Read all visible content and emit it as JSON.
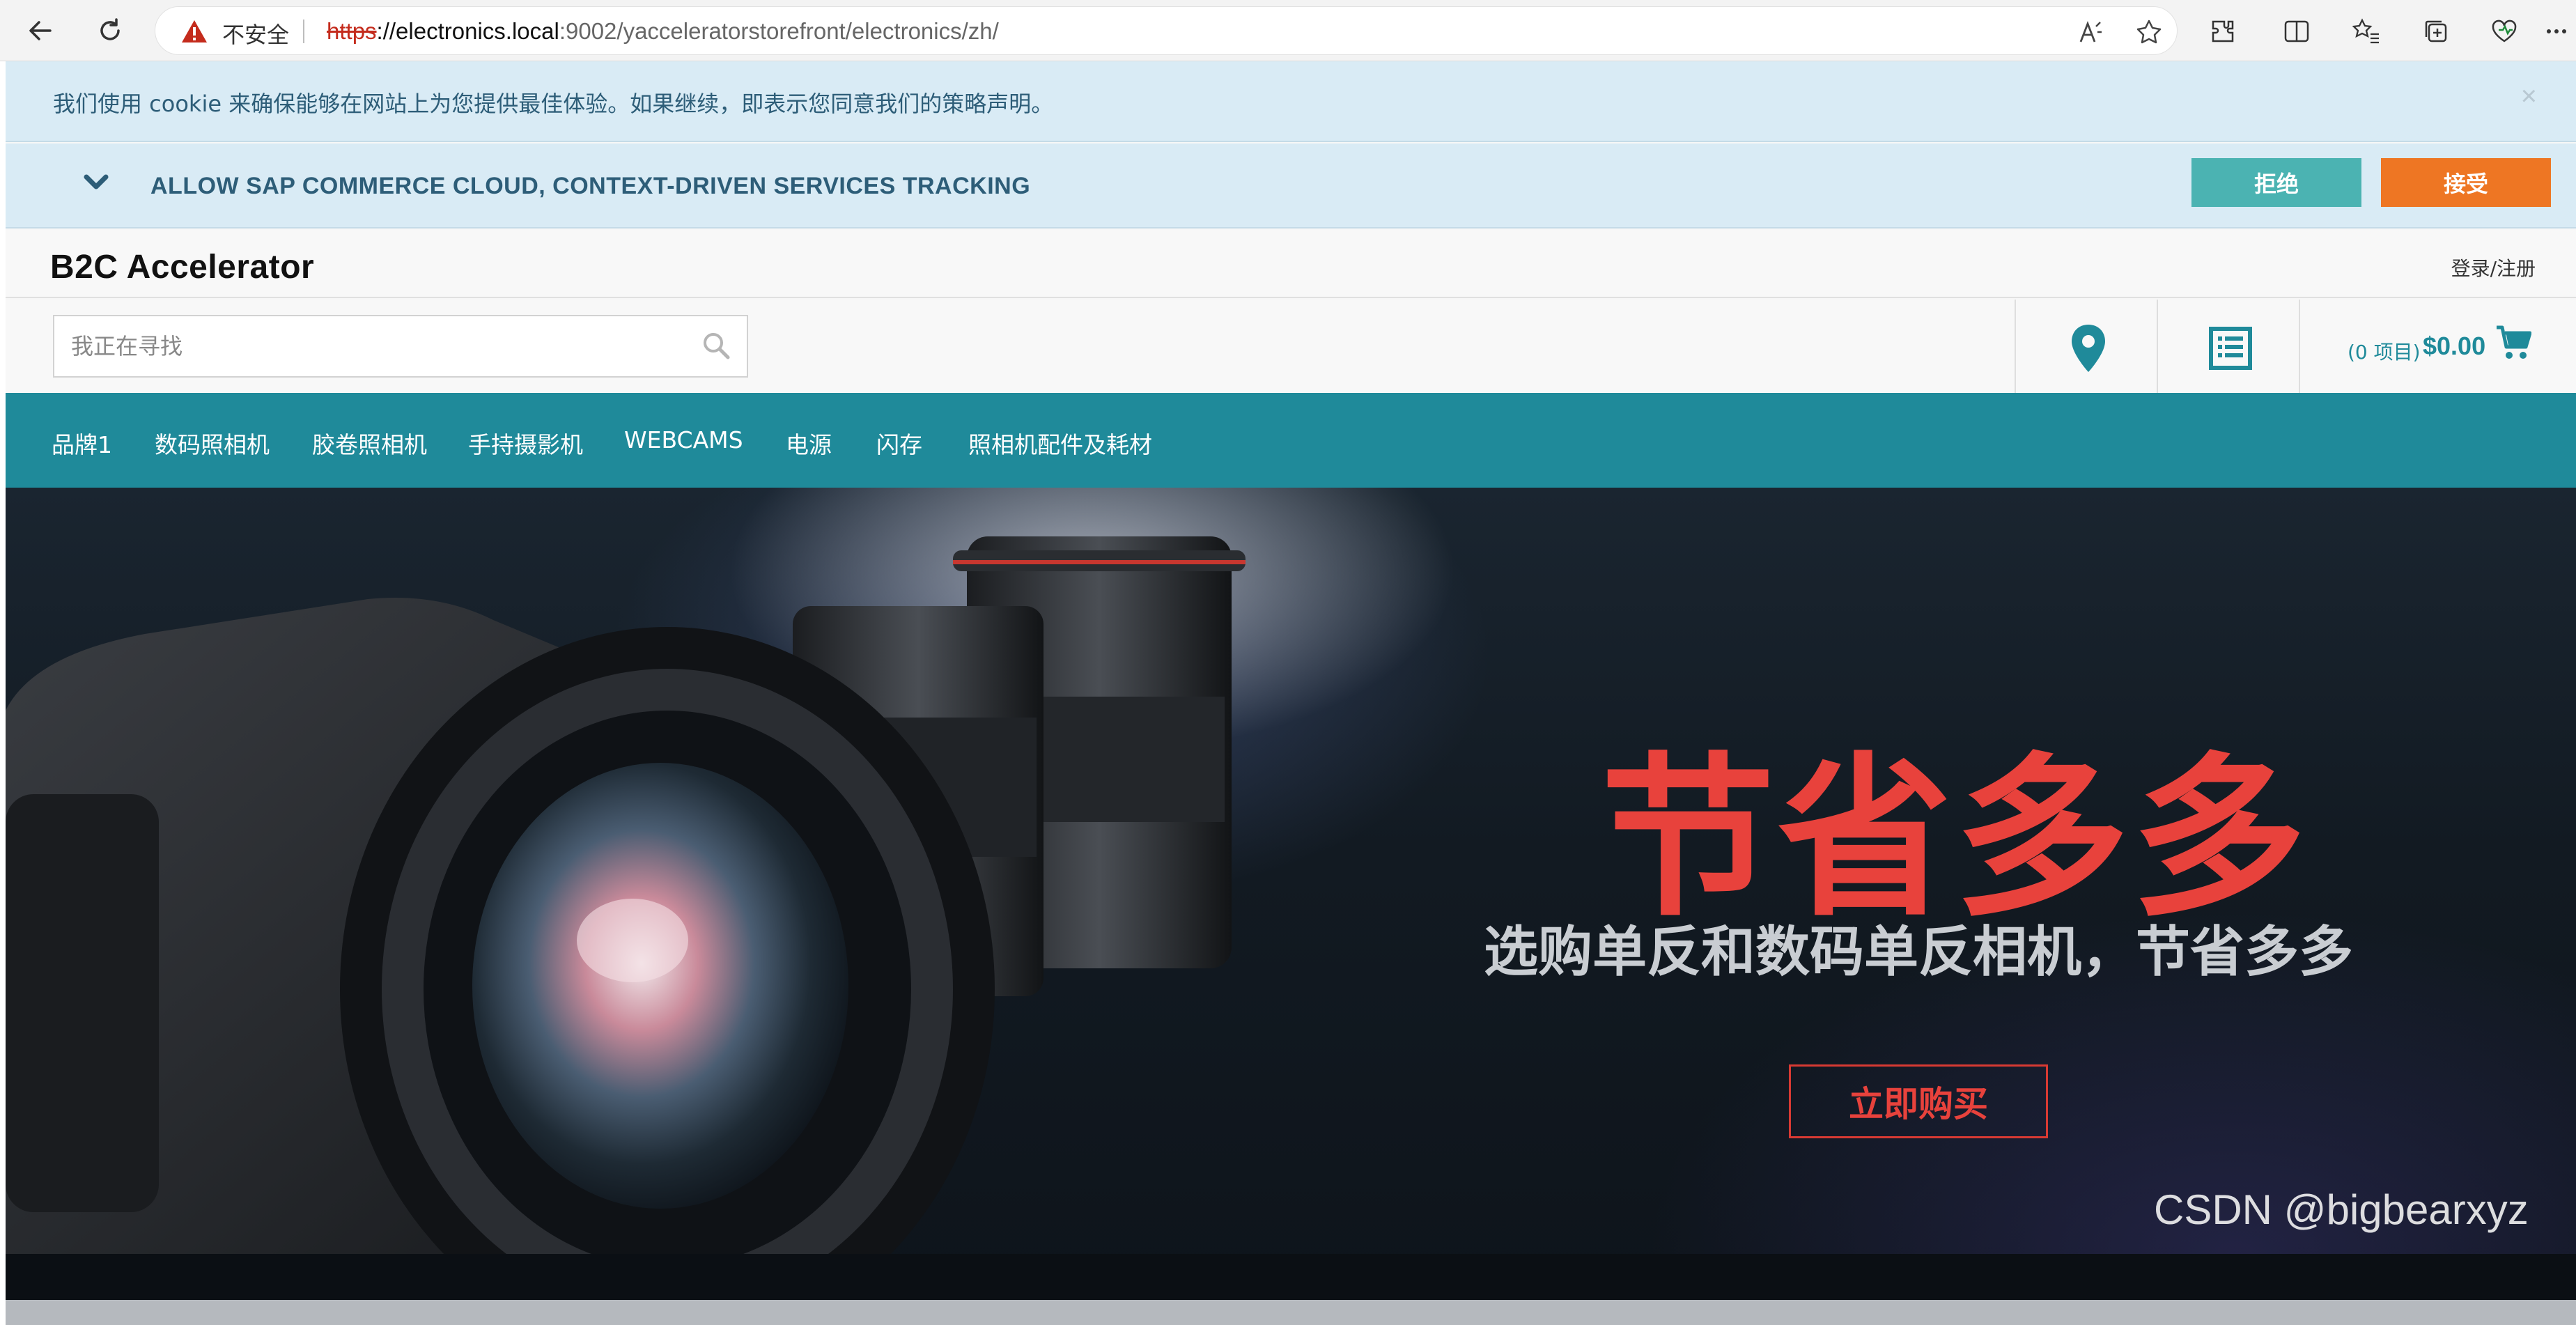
{
  "browser": {
    "security_label": "不安全",
    "url_protocol": "https",
    "url_host": "://electronics.local",
    "url_rest": ":9002/yacceleratorstorefront/electronics/zh/"
  },
  "cookie": {
    "notice": "我们使用 cookie 来确保能够在网站上为您提供最佳体验。如果继续，即表示您同意我们的策略声明。",
    "close_label": "×",
    "tracking_label": "ALLOW SAP COMMERCE CLOUD, CONTEXT-DRIVEN SERVICES TRACKING",
    "reject_label": "拒绝",
    "accept_label": "接受"
  },
  "header": {
    "brand": "B2C Accelerator",
    "login_label": "登录/注册",
    "search_placeholder": "我正在寻找",
    "cart_count": "(0 项目)",
    "cart_total": "$0.00"
  },
  "categories": [
    "品牌1",
    "数码照相机",
    "胶卷照相机",
    "手持摄影机",
    "WEBCAMS",
    "电源",
    "闪存",
    "照相机配件及耗材"
  ],
  "hero": {
    "title": "节省多多",
    "subtitle": "选购单反和数码单反相机，节省多多",
    "cta_label": "立即购买"
  },
  "watermark": "CSDN @bigbearxyz",
  "colors": {
    "teal": "#1f8a9a",
    "accept_orange": "#ee7623",
    "reject_teal": "#4bb3b2",
    "cookie_bg": "#d9ebf5",
    "hero_red": "#e8423c"
  }
}
